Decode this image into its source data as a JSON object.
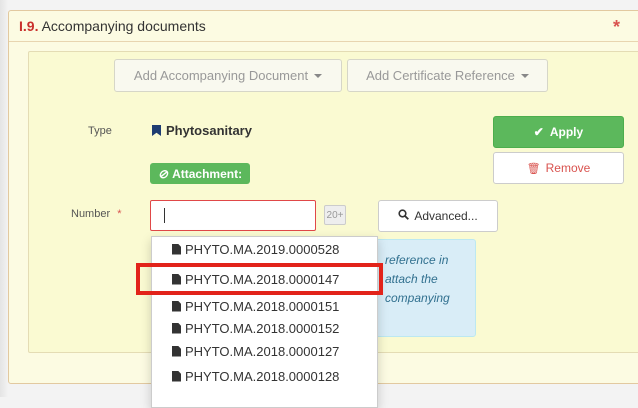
{
  "section": {
    "number": "I.9.",
    "title": "Accompanying documents",
    "required_mark": "*"
  },
  "toolbar": {
    "add_document_label": "Add Accompanying Document",
    "add_certificate_label": "Add Certificate Reference"
  },
  "form": {
    "type_label": "Type",
    "type_value": "Phytosanitary",
    "attachment_label": "Attachment:",
    "number_label": "Number",
    "number_required": "*",
    "number_value": "",
    "count_badge": "20+",
    "advanced_label": "Advanced...",
    "apply_label": "Apply",
    "remove_label": "Remove",
    "info_text": "reference in\nattach the\ncompanying"
  },
  "dropdown": {
    "items": [
      "PHYTO.MA.2019.0000528",
      "PHYTO.MA.2018.0000147",
      "PHYTO.MA.2018.0000151",
      "PHYTO.MA.2018.0000152",
      "PHYTO.MA.2018.0000127",
      "PHYTO.MA.2018.0000128"
    ],
    "highlighted_index": 1
  },
  "colors": {
    "panel_bg": "#fcfbe2",
    "inner_bg": "#fafad2",
    "success": "#5cb85c",
    "danger": "#d9534f",
    "info_bg": "#d9edf7",
    "highlight": "#e2231a"
  },
  "icons": {
    "bookmark": "bookmark-icon",
    "attachment": "paperclip-icon",
    "apply": "check-icon",
    "remove": "trash-icon",
    "advanced": "search-icon",
    "doc": "file-icon",
    "caret": "caret-down-icon"
  }
}
